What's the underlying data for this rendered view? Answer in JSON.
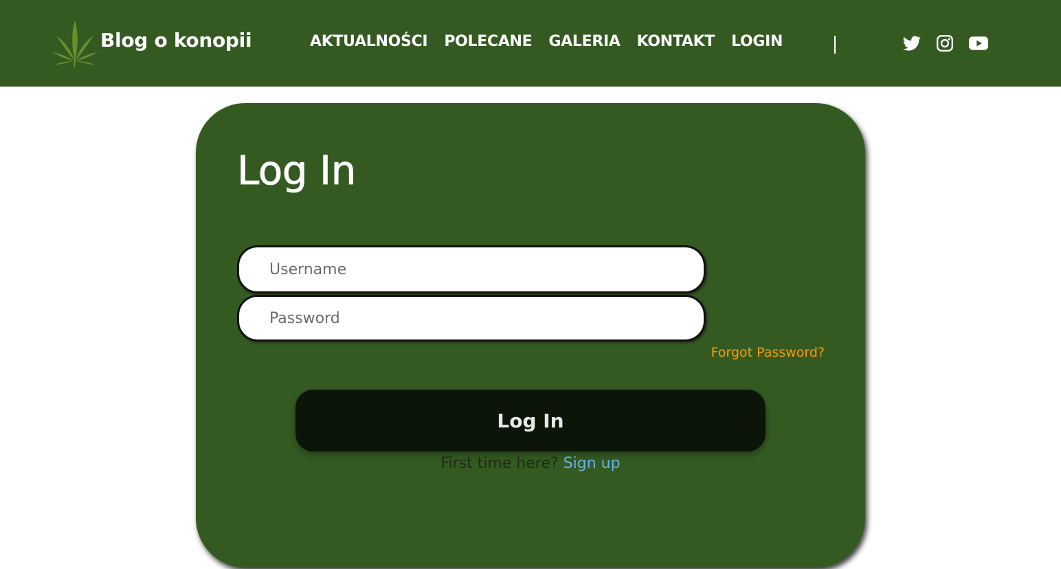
{
  "header": {
    "brand": "Blog o konopii",
    "logo_icon": "cannabis-leaf-icon",
    "nav": [
      {
        "label": "AKTUALNOŚCI"
      },
      {
        "label": "POLECANE"
      },
      {
        "label": "GALERIA"
      },
      {
        "label": "KONTAKT"
      },
      {
        "label": "LOGIN"
      }
    ],
    "divider": "|",
    "social": [
      "twitter-icon",
      "instagram-icon",
      "youtube-icon"
    ],
    "background": "#345a22"
  },
  "login": {
    "title": "Log In",
    "username_placeholder": "Username",
    "password_placeholder": "Password",
    "forgot": "Forgot Password?",
    "submit": "Log In",
    "first_time": "First time here?",
    "signup": "Sign up"
  },
  "colors": {
    "primary_green": "#345a22",
    "button_dark": "#0b1508",
    "forgot_orange": "#ff9d00",
    "signup_blue": "#6ab0e8"
  }
}
